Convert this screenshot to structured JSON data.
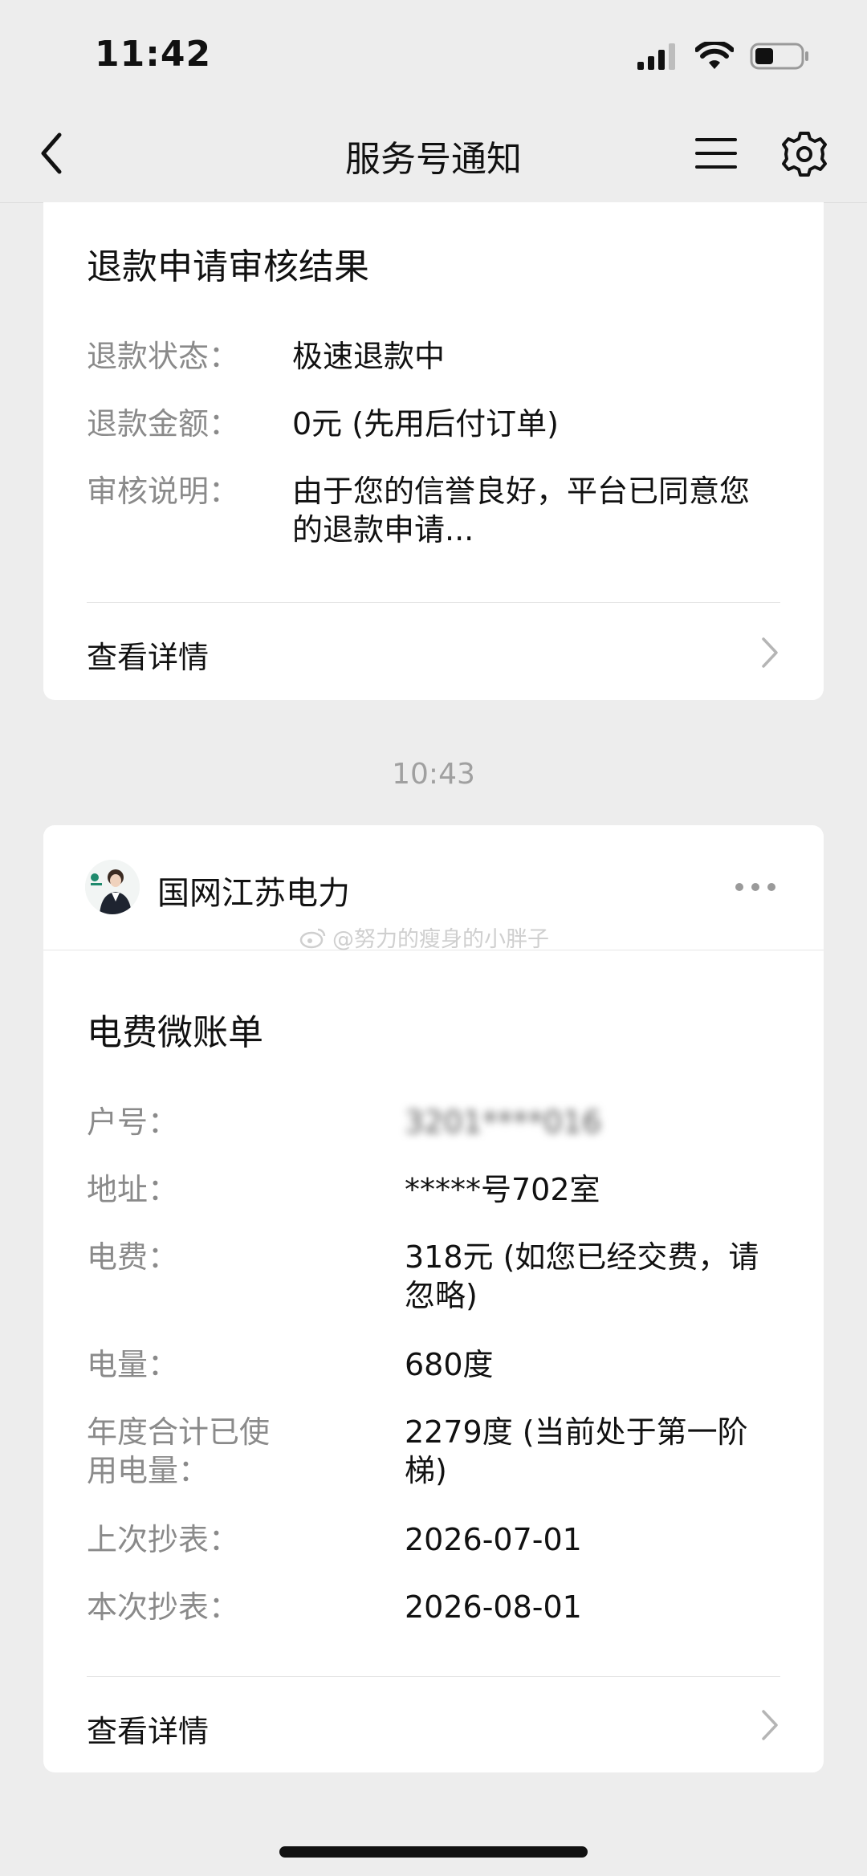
{
  "status_bar": {
    "time": "11:42"
  },
  "nav": {
    "title": "服务号通知"
  },
  "refund_card": {
    "title": "退款申请审核结果",
    "rows": [
      {
        "label": "退款状态：",
        "value": "极速退款中"
      },
      {
        "label": "退款金额：",
        "value": "0元 (先用后付订单)"
      },
      {
        "label": "审核说明：",
        "value": "由于您的信誉良好，平台已同意您的退款申请..."
      }
    ],
    "details_link": "查看详情"
  },
  "timestamp": "10:43",
  "bill_card": {
    "account_name": "国网江苏电力",
    "watermark": "@努力的瘦身的小胖子",
    "title": "电费微账单",
    "rows": [
      {
        "label": "户号：",
        "value": "3201****016"
      },
      {
        "label": "地址：",
        "value": "*****号702室"
      },
      {
        "label": "电费：",
        "value": "318元 (如您已经交费，请忽略)"
      },
      {
        "label": "电量：",
        "value": "680度"
      },
      {
        "label": "年度合计已使用电量：",
        "value": "2279度 (当前处于第一阶梯)"
      },
      {
        "label": "上次抄表：",
        "value": "2026-07-01"
      },
      {
        "label": "本次抄表：",
        "value": "2026-08-01"
      }
    ],
    "details_link": "查看详情"
  },
  "icons": {
    "back": "chevron-left-icon",
    "menu": "menu-icon",
    "settings": "gear-icon",
    "chevron": "chevron-right-icon",
    "more": "more-icon"
  },
  "colors": {
    "background": "#ededed",
    "card": "#ffffff",
    "label": "#8a8a8a",
    "timestamp": "#a0a0a0"
  }
}
